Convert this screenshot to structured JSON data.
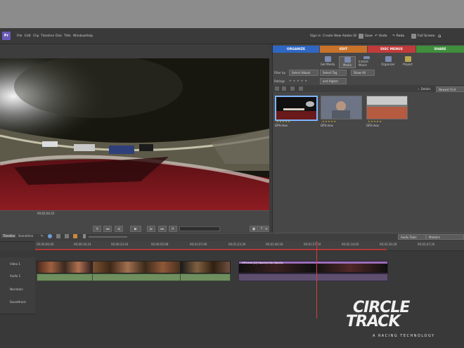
{
  "app": {
    "logo": "Pr"
  },
  "menu": [
    "File",
    "Edit",
    "Clip",
    "Timeline",
    "Disc",
    "Title",
    "Window",
    "Help"
  ],
  "toolbar": {
    "signin": "Sign in",
    "adobe_id": "Create New Adobe ID",
    "save": "Save",
    "undo": "Undo",
    "redo": "Redo",
    "fullscreen": "Full Screen"
  },
  "tabs": [
    {
      "label": "ORGANIZE",
      "color": "#2f67c5"
    },
    {
      "label": "EDIT",
      "color": "#c9722a"
    },
    {
      "label": "DISC MENUS",
      "color": "#c23b3b"
    },
    {
      "label": "SHARE",
      "color": "#3f8f3c"
    }
  ],
  "tools": [
    "Get Media",
    "Media",
    "Instant Movie",
    "Organizer",
    "Project"
  ],
  "filters": {
    "filter_by": "Filter by",
    "album": "Select Album",
    "tag": "Select Tag",
    "show_all": "Show All",
    "ratings": "Ratings",
    "and_higher": "and Higher"
  },
  "options": {
    "details": "Details",
    "sort": "Newest First"
  },
  "media": [
    {
      "name": "GP4.mov",
      "selected": true
    },
    {
      "name": "GP3.mov",
      "selected": false
    },
    {
      "name": "GP2.mov",
      "selected": false
    }
  ],
  "monitor": {
    "timecode": "00;02;04;22"
  },
  "timeline": {
    "tabs": [
      "Timeline",
      "Scenetime"
    ],
    "audio_tools": "Audio Tools",
    "markers": "Markers",
    "ticks": [
      "00;00;00;00",
      "00;00;16;24",
      "00;00;33;16",
      "00;00;50;08",
      "00;01;07;00",
      "00;01;23;26",
      "00;01;40;18",
      "00;01;57;10",
      "00;02;14;02",
      "00;02;30;28",
      "00;02;47;20"
    ],
    "tracks": [
      "Video 1",
      "Audio 1",
      "Narration",
      "Soundtrack"
    ],
    "clip_label": "GP4.mov [V] Opacity:Clip Opacity"
  },
  "watermark": {
    "line1": "CIRCLE",
    "line2": "TRACK",
    "tagline": "A RACING TECHNOLOGY"
  }
}
